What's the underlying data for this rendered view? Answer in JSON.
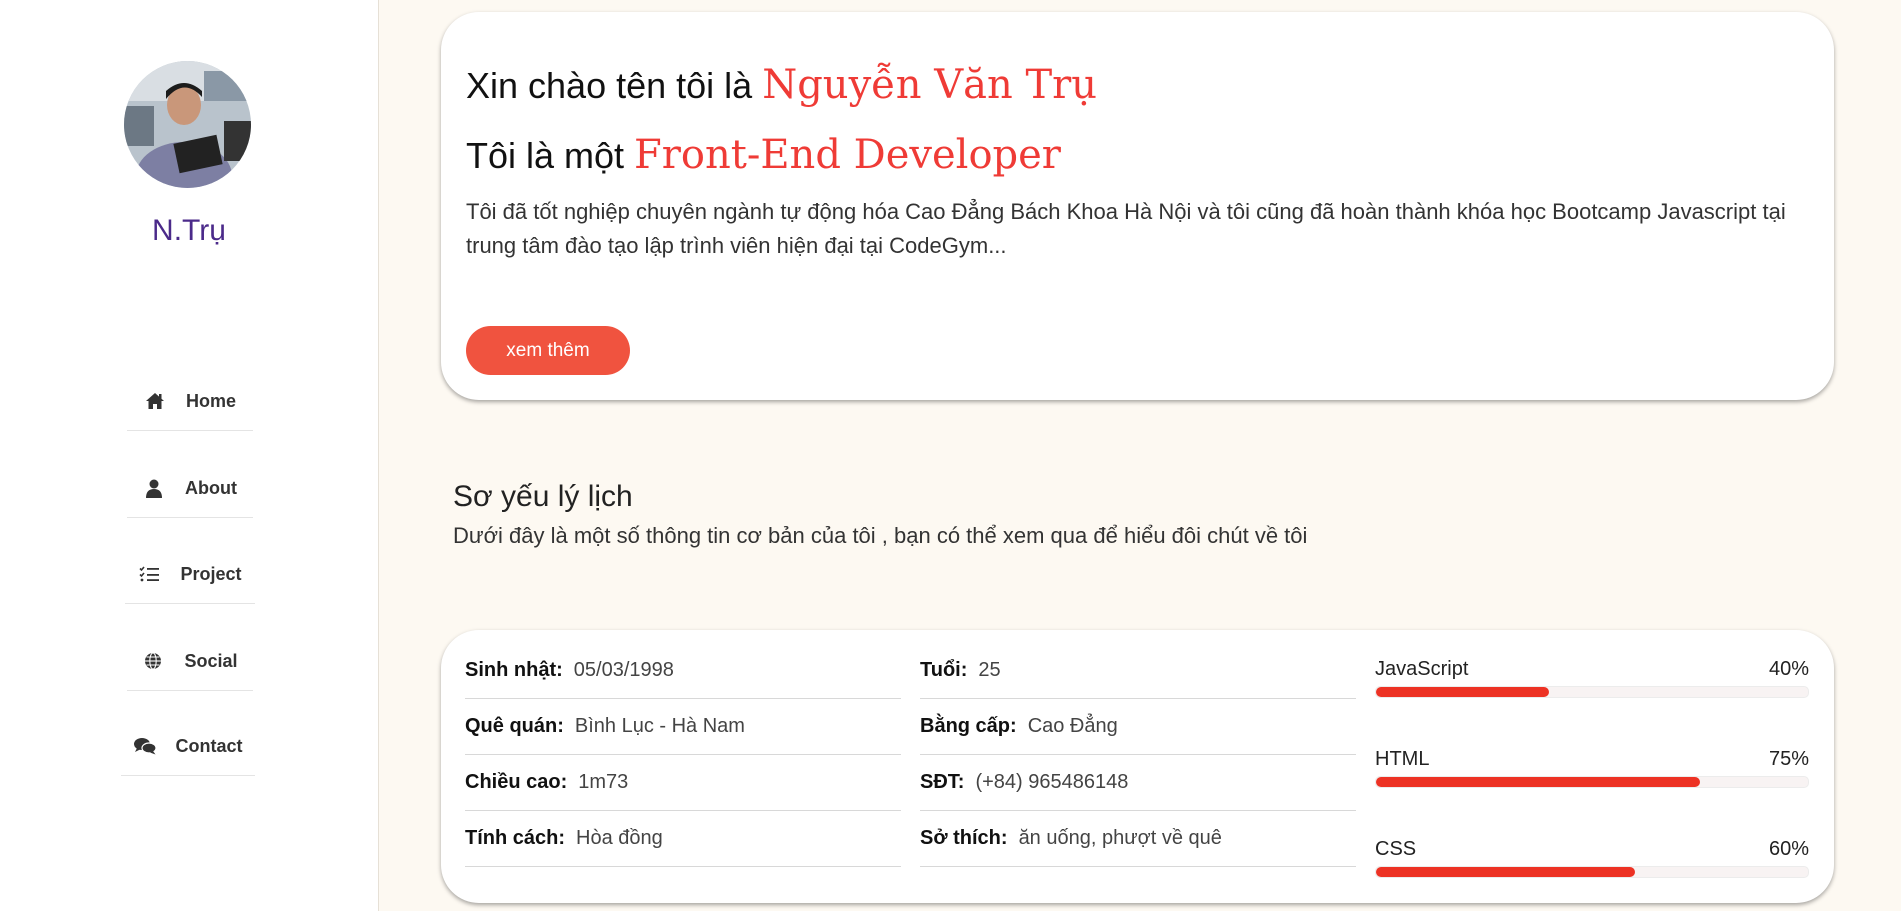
{
  "sidebar": {
    "brand": "N.Trụ",
    "nav": [
      {
        "label": "Home",
        "icon": "home-icon"
      },
      {
        "label": "About",
        "icon": "user-icon"
      },
      {
        "label": "Project",
        "icon": "list-check-icon"
      },
      {
        "label": "Social",
        "icon": "globe-icon"
      },
      {
        "label": "Contact",
        "icon": "comments-icon"
      }
    ]
  },
  "intro": {
    "line1_prefix": "Xin chào tên tôi là ",
    "line1_name": "Nguyễn Văn Trụ",
    "line2_prefix": "Tôi là một ",
    "line2_role": "Front-End Developer",
    "description": "Tôi đã tốt nghiệp chuyên ngành tự động hóa Cao Đẳng Bách Khoa Hà Nội và tôi cũng đã hoàn thành khóa học Bootcamp Javascript tại trung tâm đào tạo lập trình viên hiện đại tại CodeGym...",
    "button": "xem thêm"
  },
  "resume": {
    "title": "Sơ yếu lý lịch",
    "subtitle": "Dưới đây là một số thông tin cơ bản của tôi , bạn có thể xem qua để hiểu đôi chút về tôi",
    "info_left": [
      {
        "label": "Sinh nhật:",
        "value": "05/03/1998"
      },
      {
        "label": "Quê quán:",
        "value": "Bình Lục - Hà Nam"
      },
      {
        "label": "Chiều cao:",
        "value": "1m73"
      },
      {
        "label": "Tính cách:",
        "value": "Hòa đồng"
      }
    ],
    "info_right": [
      {
        "label": "Tuổi:",
        "value": "25"
      },
      {
        "label": "Bằng cấp:",
        "value": "Cao Đẳng"
      },
      {
        "label": "SĐT:",
        "value": "(+84) 965486148"
      },
      {
        "label": "Sở thích:",
        "value": "ăn uống, phượt về quê"
      }
    ],
    "skills": [
      {
        "name": "JavaScript",
        "percent_label": "40%",
        "percent": 40
      },
      {
        "name": "HTML",
        "percent_label": "75%",
        "percent": 75
      },
      {
        "name": "CSS",
        "percent_label": "60%",
        "percent": 60
      }
    ]
  },
  "colors": {
    "accent": "#ef3b36",
    "button": "#f0533f",
    "progress": "#ed3224",
    "brand": "#4b2a8a",
    "background": "#fdf9f2"
  }
}
